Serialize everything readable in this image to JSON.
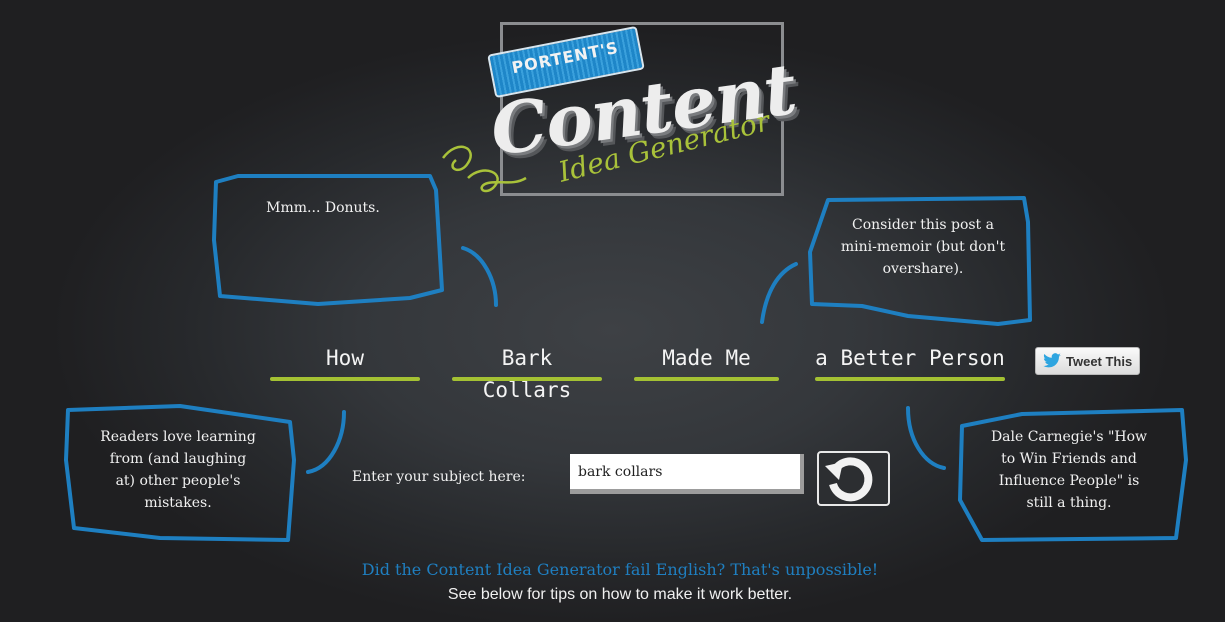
{
  "logo": {
    "banner_text": "PORTENT'S",
    "title_text": "Content",
    "subtitle_text": "Idea Generator"
  },
  "bubbles": {
    "top_left": "Mmm... Donuts.",
    "top_right": "Consider this post a mini-memoir (but don't overshare).",
    "bottom_left": "Readers love learning from (and laughing at) other people's mistakes.",
    "bottom_right": "Dale Carnegie's \"How to Win Friends and Influence People\" is still a thing."
  },
  "headline": {
    "words": [
      "How",
      "Bark Collars",
      "Made Me",
      "a Better Person"
    ]
  },
  "tweet_button": {
    "label": "Tweet This",
    "icon": "twitter-bird-icon"
  },
  "subject": {
    "label": "Enter your subject here:",
    "value": "bark collars",
    "refresh_icon": "refresh-icon"
  },
  "footer": {
    "fail_message": "Did the Content Idea Generator fail English? That's unpossible!",
    "tips_message": "See below for tips on how to make it work better."
  },
  "colors": {
    "background": "#1f1f21",
    "bubble_stroke": "#1e7fc1",
    "underline": "#a4c133",
    "fail_text": "#1f7fc0"
  }
}
